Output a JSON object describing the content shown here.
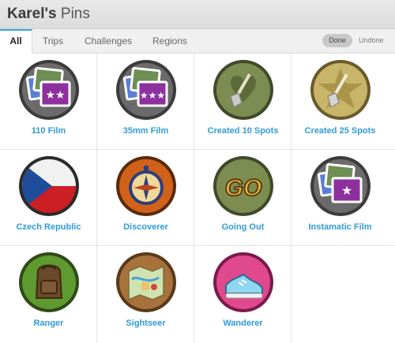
{
  "header": {
    "owner": "Karel's",
    "section": "Pins"
  },
  "tabs": [
    {
      "label": "All",
      "active": true
    },
    {
      "label": "Trips"
    },
    {
      "label": "Challenges"
    },
    {
      "label": "Regions"
    }
  ],
  "filter": {
    "done": "Done",
    "undone": "Undone"
  },
  "pins": [
    {
      "label": "110 Film",
      "icon": "film-photos-icon"
    },
    {
      "label": "35mm Film",
      "icon": "film-photos-icon"
    },
    {
      "label": "Created 10 Spots",
      "icon": "shovel-icon"
    },
    {
      "label": "Created 25 Spots",
      "icon": "shovel-star-icon"
    },
    {
      "label": "Czech Republic",
      "icon": "czech-flag-icon"
    },
    {
      "label": "Discoverer",
      "icon": "compass-icon"
    },
    {
      "label": "Going Out",
      "icon": "go-icon"
    },
    {
      "label": "Instamatic Film",
      "icon": "film-photos-icon"
    },
    {
      "label": "Ranger",
      "icon": "backpack-icon"
    },
    {
      "label": "Sightseer",
      "icon": "map-icon"
    },
    {
      "label": "Wanderer",
      "icon": "sneaker-icon"
    }
  ],
  "colors": {
    "link": "#2e9bd6",
    "active_tab_accent": "#3aa7dd"
  }
}
